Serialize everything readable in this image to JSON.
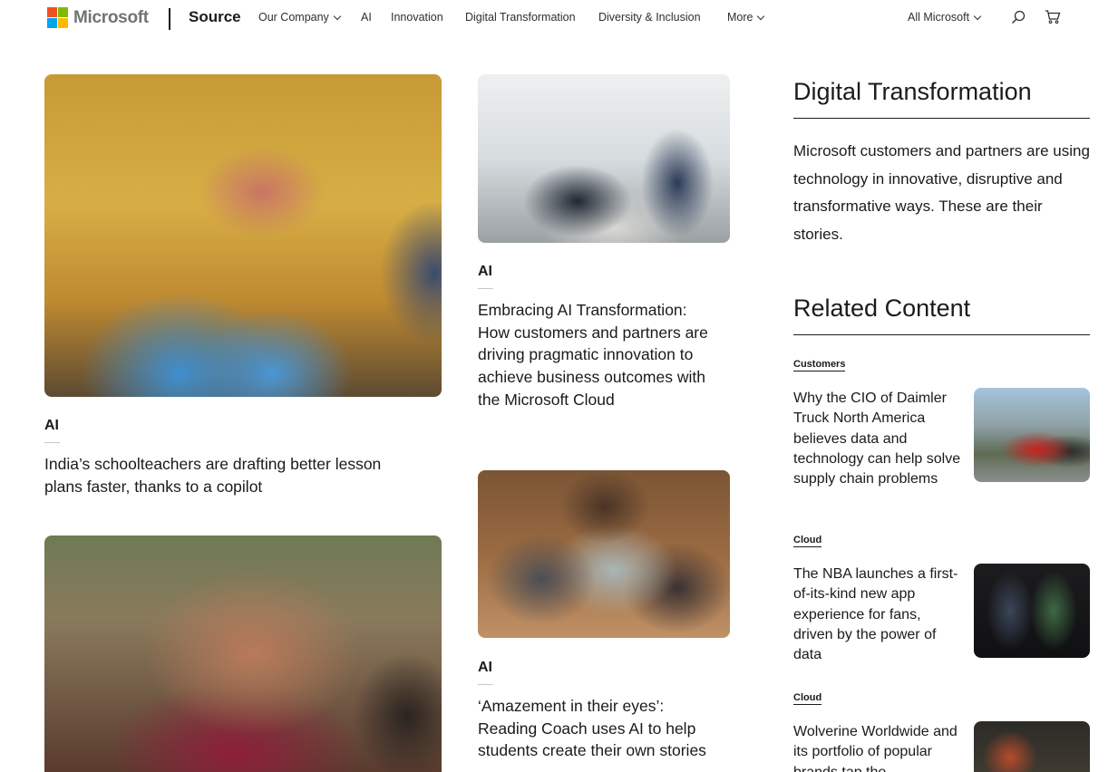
{
  "header": {
    "brand": "Microsoft",
    "site": "Source",
    "nav": {
      "our_company": "Our Company",
      "ai": "AI",
      "innovation": "Innovation",
      "digital_transformation": "Digital Transformation",
      "diversity": "Diversity & Inclusion",
      "more": "More"
    },
    "all_microsoft": "All Microsoft",
    "icons": [
      "search-icon",
      "cart-icon",
      "chevron-down-icon"
    ]
  },
  "brand_colors": {
    "red": "#f25022",
    "green": "#7fba00",
    "blue": "#00a4ef",
    "yellow": "#ffb900"
  },
  "articles": [
    {
      "category": "AI",
      "title": "India’s schoolteachers are drafting better lesson plans faster, thanks to a copilot"
    },
    {
      "category": "AI",
      "title": "Embracing AI Transformation: How customers and partners are driving pragmatic innovation to achieve business outcomes with the Microsoft Cloud"
    },
    {
      "category": "AI",
      "title": "‘Amazement in their eyes’: Reading Coach uses AI to help students create their own stories"
    }
  ],
  "sidebar": {
    "heading": "Digital Transformation",
    "description": "Microsoft customers and partners are using technology in innovative, disruptive and transformative ways. These are their stories.",
    "related_heading": "Related Content",
    "related": [
      {
        "category": "Customers",
        "title": "Why the CIO of Daimler Truck North America believes data and technology can help solve supply chain problems"
      },
      {
        "category": "Cloud",
        "title": "The NBA launches a first-of-its-kind new app experience for fans, driven by the power of data"
      },
      {
        "category": "Cloud",
        "title": "Wolverine Worldwide and its portfolio of popular brands tap the"
      }
    ]
  }
}
